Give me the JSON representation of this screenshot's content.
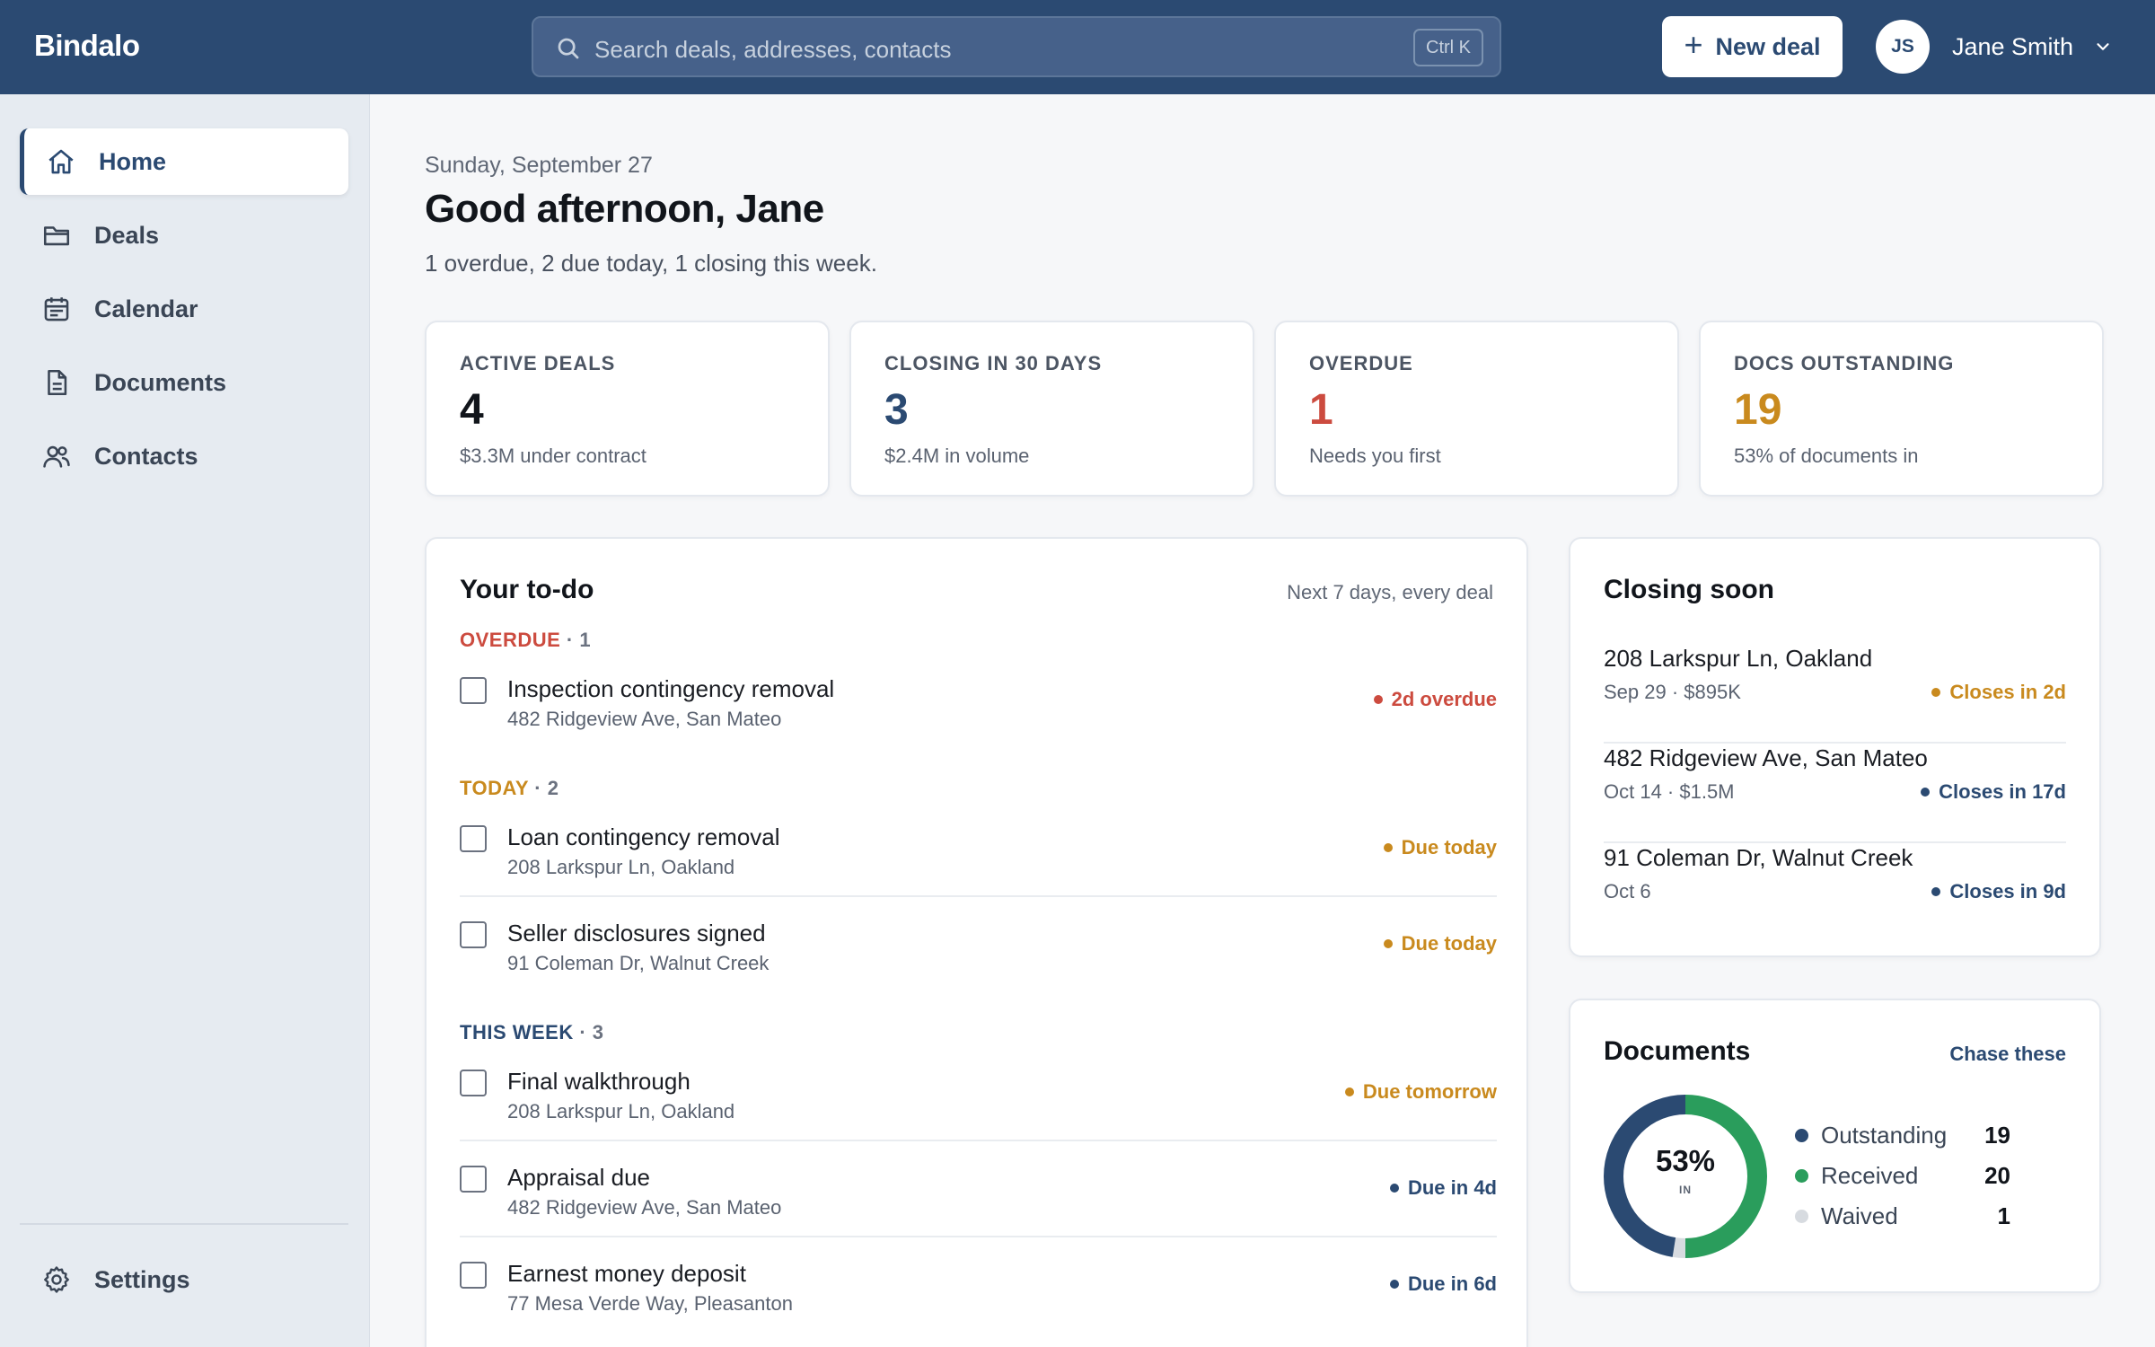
{
  "app": {
    "brand": "Bindalo"
  },
  "search": {
    "placeholder": "Search deals, addresses, contacts",
    "shortcut": "Ctrl K"
  },
  "header": {
    "new_deal_label": "New deal",
    "user_initials": "JS",
    "user_name": "Jane Smith"
  },
  "sidebar": {
    "items": [
      {
        "label": "Home",
        "icon": "home-icon",
        "active": true
      },
      {
        "label": "Deals",
        "icon": "folder-icon"
      },
      {
        "label": "Calendar",
        "icon": "calendar-icon"
      },
      {
        "label": "Documents",
        "icon": "document-icon"
      },
      {
        "label": "Contacts",
        "icon": "users-icon"
      }
    ],
    "settings_label": "Settings"
  },
  "page": {
    "date": "Sunday, September 27",
    "greeting": "Good afternoon, Jane",
    "summary": "1 overdue, 2 due today, 1 closing this week."
  },
  "stats": [
    {
      "label": "ACTIVE DEALS",
      "value": "4",
      "sub": "$3.3M under contract",
      "color": "#11151b"
    },
    {
      "label": "CLOSING IN 30 DAYS",
      "value": "3",
      "sub": "$2.4M in volume",
      "color": "#2b4a72"
    },
    {
      "label": "OVERDUE",
      "value": "1",
      "sub": "Needs you first",
      "color": "#cc4b3f"
    },
    {
      "label": "DOCS OUTSTANDING",
      "value": "19",
      "sub": "53% of documents in",
      "color": "#c98a1e"
    }
  ],
  "todo": {
    "title": "Your to-do",
    "hint": "Next 7 days, every deal",
    "groups": [
      {
        "label": "OVERDUE",
        "count": "1",
        "color": "#cc4b3f"
      },
      {
        "label": "TODAY",
        "count": "2",
        "color": "#c98a1e"
      },
      {
        "label": "THIS WEEK",
        "count": "3",
        "color": "#2b4a72"
      }
    ],
    "tasks": [
      {
        "title": "Inspection contingency removal",
        "address": "482 Ridgeview Ave, San Mateo",
        "due": "2d overdue",
        "color": "#cc4b3f"
      },
      {
        "title": "Loan contingency removal",
        "address": "208 Larkspur Ln, Oakland",
        "due": "Due today",
        "color": "#c98a1e"
      },
      {
        "title": "Seller disclosures signed",
        "address": "91 Coleman Dr, Walnut Creek",
        "due": "Due today",
        "color": "#c98a1e"
      },
      {
        "title": "Final walkthrough",
        "address": "208 Larkspur Ln, Oakland",
        "due": "Due tomorrow",
        "color": "#c98a1e"
      },
      {
        "title": "Appraisal due",
        "address": "482 Ridgeview Ave, San Mateo",
        "due": "Due in 4d",
        "color": "#2b4a72"
      },
      {
        "title": "Earnest money deposit",
        "address": "77 Mesa Verde Way, Pleasanton",
        "due": "Due in 6d",
        "color": "#2b4a72"
      }
    ]
  },
  "closing": {
    "title": "Closing soon",
    "items": [
      {
        "address": "208 Larkspur Ln, Oakland",
        "meta": "Sep 29 · $895K",
        "status": "Closes in 2d",
        "color": "#c98a1e"
      },
      {
        "address": "482 Ridgeview Ave, San Mateo",
        "meta": "Oct 14 · $1.5M",
        "status": "Closes in 17d",
        "color": "#2b4a72"
      },
      {
        "address": "91 Coleman Dr, Walnut Creek",
        "meta": "Oct 6",
        "status": "Closes in 9d",
        "color": "#2b4a72"
      }
    ]
  },
  "documents": {
    "title": "Documents",
    "chase_label": "Chase these",
    "percent_label": "53%",
    "percent_sub": "IN",
    "legend": [
      {
        "label": "Outstanding",
        "value": 19,
        "color": "#2b4a72"
      },
      {
        "label": "Received",
        "value": 20,
        "color": "#2a9d5c"
      },
      {
        "label": "Waived",
        "value": 1,
        "color": "#d7dbe0"
      }
    ]
  }
}
